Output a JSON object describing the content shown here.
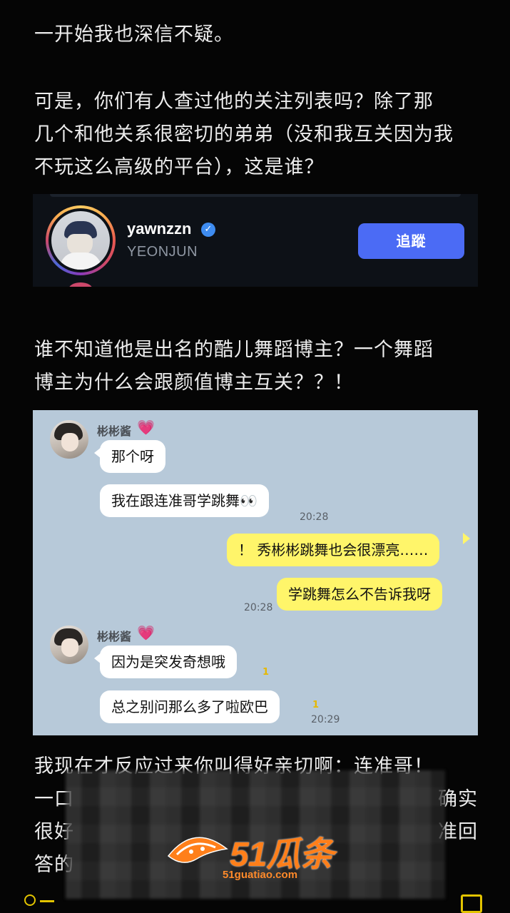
{
  "post": {
    "line1": "一开始我也深信不疑。",
    "para2": [
      "可是，你们有人查过他的关注列表吗？除了那",
      "几个和他关系很密切的弟弟（没和我互关因为我",
      "不玩这么高级的平台），这是谁？"
    ],
    "para3": [
      "谁不知道他是出名的酷儿舞蹈博主？一个舞蹈",
      "博主为什么会跟颜值博主互关？？！"
    ],
    "para4": [
      "我现在才反应过来你叫得好亲切啊：连准哥！",
      "一口",
      "很好",
      "答的"
    ],
    "para4_right": [
      "确实",
      "准回"
    ]
  },
  "follow_card": {
    "handle": "yawnzzn",
    "subname": "YEONJUN",
    "button_label": "追蹤",
    "verified_glyph": "✓",
    "button_color": "#4b6bf5"
  },
  "chat": {
    "sender_name": "彬彬酱",
    "heart": "💗",
    "messages": [
      {
        "side": "left",
        "text": "那个呀"
      },
      {
        "side": "left",
        "text": "我在跟连准哥学跳舞👀",
        "time": "20:28"
      },
      {
        "side": "right",
        "text": "！ 秀彬彬跳舞也会很漂亮……"
      },
      {
        "side": "right",
        "text": "学跳舞怎么不告诉我呀",
        "time": "20:28"
      },
      {
        "side": "left",
        "text": "因为是突发奇想哦",
        "unread": "1"
      },
      {
        "side": "left",
        "text": "总之别问那么多了啦欧巴",
        "unread": "1",
        "time": "20:29"
      }
    ]
  },
  "watermark": {
    "brand": "51瓜条",
    "url": "51guatiao.com"
  }
}
